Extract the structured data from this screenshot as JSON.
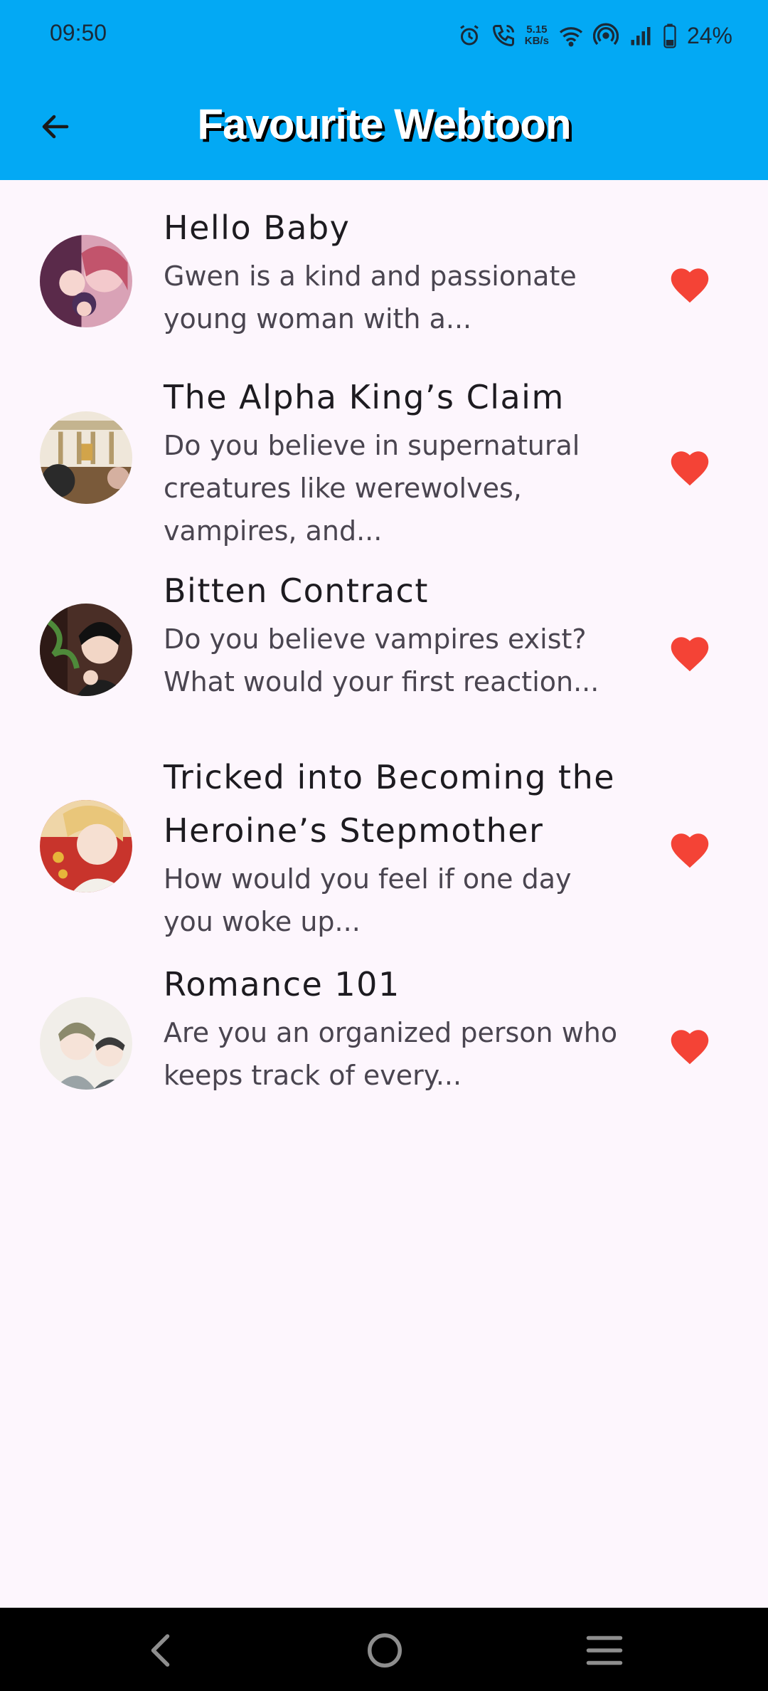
{
  "status_bar": {
    "time": "09:50",
    "net_speed_value": "5.15",
    "net_speed_unit": "KB/s",
    "battery": "24%"
  },
  "app_bar": {
    "title": "Favourite Webtoon",
    "back_icon": "arrow-left-icon"
  },
  "colors": {
    "primary": "#03a9f4",
    "heart": "#f44336",
    "background": "#fdf6fd"
  },
  "favourites": [
    {
      "title_lines": [
        "Hello Baby"
      ],
      "desc_lines": [
        "Gwen is a kind and passionate",
        "young woman with a..."
      ],
      "favourited": true
    },
    {
      "title_lines": [
        "The Alpha King’s Claim"
      ],
      "desc_lines": [
        "Do you believe in supernatural",
        "creatures like werewolves,",
        "vampires, and..."
      ],
      "favourited": true
    },
    {
      "title_lines": [
        "Bitten Contract"
      ],
      "desc_lines": [
        "Do you believe vampires exist?",
        "What would your first reaction..."
      ],
      "favourited": true
    },
    {
      "title_lines": [
        "Tricked into Becoming the",
        "Heroine’s Stepmother"
      ],
      "desc_lines": [
        "How would you feel if one day",
        "you woke up..."
      ],
      "favourited": true
    },
    {
      "title_lines": [
        "Romance 101"
      ],
      "desc_lines": [
        "Are you an organized person who",
        "keeps track of every..."
      ],
      "favourited": true
    }
  ],
  "nav_bar": {
    "back_icon": "nav-back-icon",
    "home_icon": "nav-home-icon",
    "menu_icon": "nav-menu-icon"
  }
}
